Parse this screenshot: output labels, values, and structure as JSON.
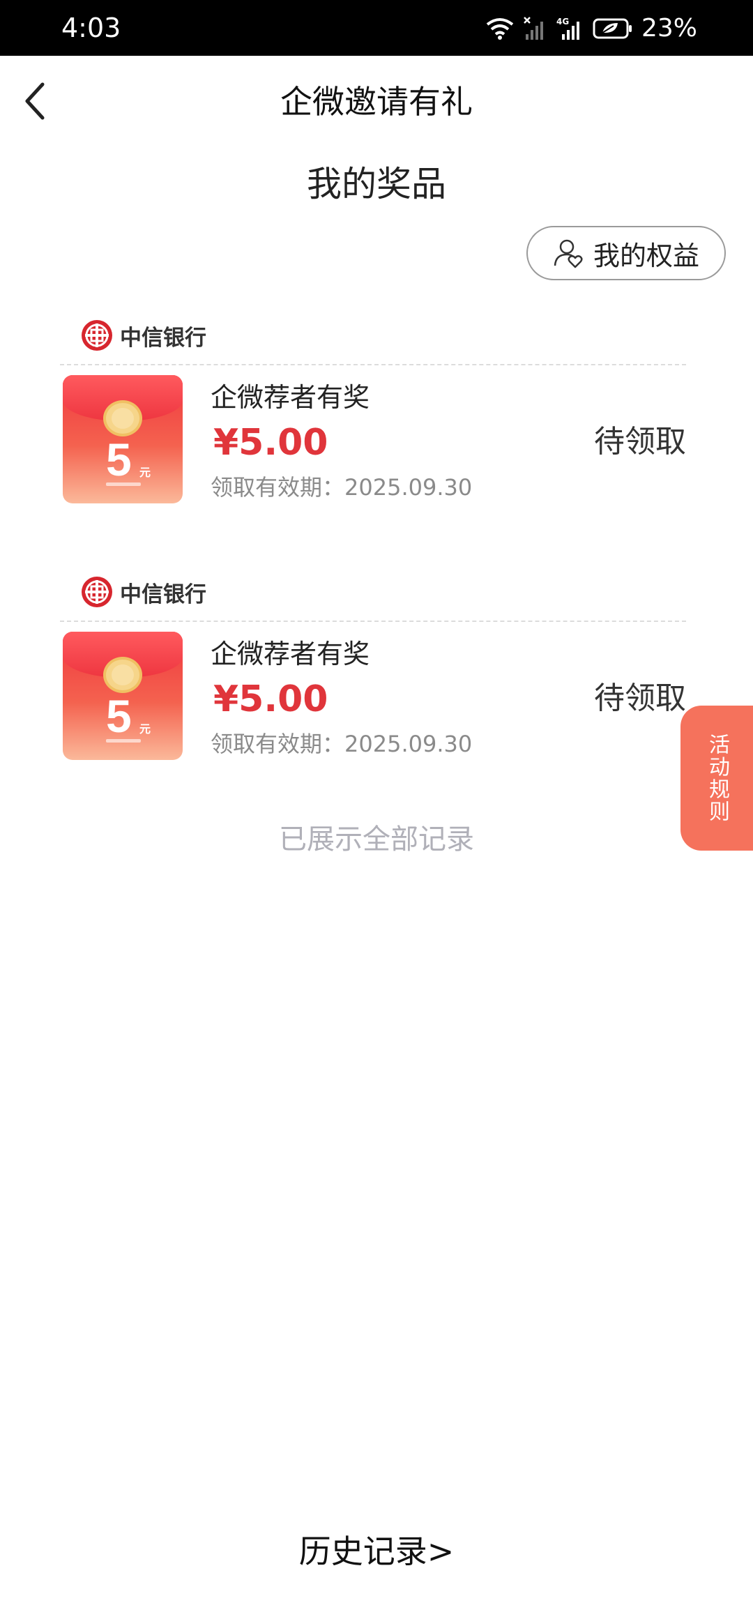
{
  "status_bar": {
    "time": "4:03",
    "battery": "23%"
  },
  "nav": {
    "title": "企微邀请有礼"
  },
  "section_title": "我的奖品",
  "benefits_button": "我的权益",
  "prizes": [
    {
      "bank": "中信银行",
      "name": "企微荐者有奖",
      "amount": "¥5.00",
      "expiry": "领取有效期：2025.09.30",
      "status": "待领取",
      "thumb_value": "5",
      "thumb_unit": "元"
    },
    {
      "bank": "中信银行",
      "name": "企微荐者有奖",
      "amount": "¥5.00",
      "expiry": "领取有效期：2025.09.30",
      "status": "待领取",
      "thumb_value": "5",
      "thumb_unit": "元"
    }
  ],
  "all_shown_text": "已展示全部记录",
  "rules_tab": "活动规则",
  "history_link": "历史记录>",
  "colors": {
    "accent_red": "#e0353b",
    "rules_tab": "#f5725c"
  }
}
